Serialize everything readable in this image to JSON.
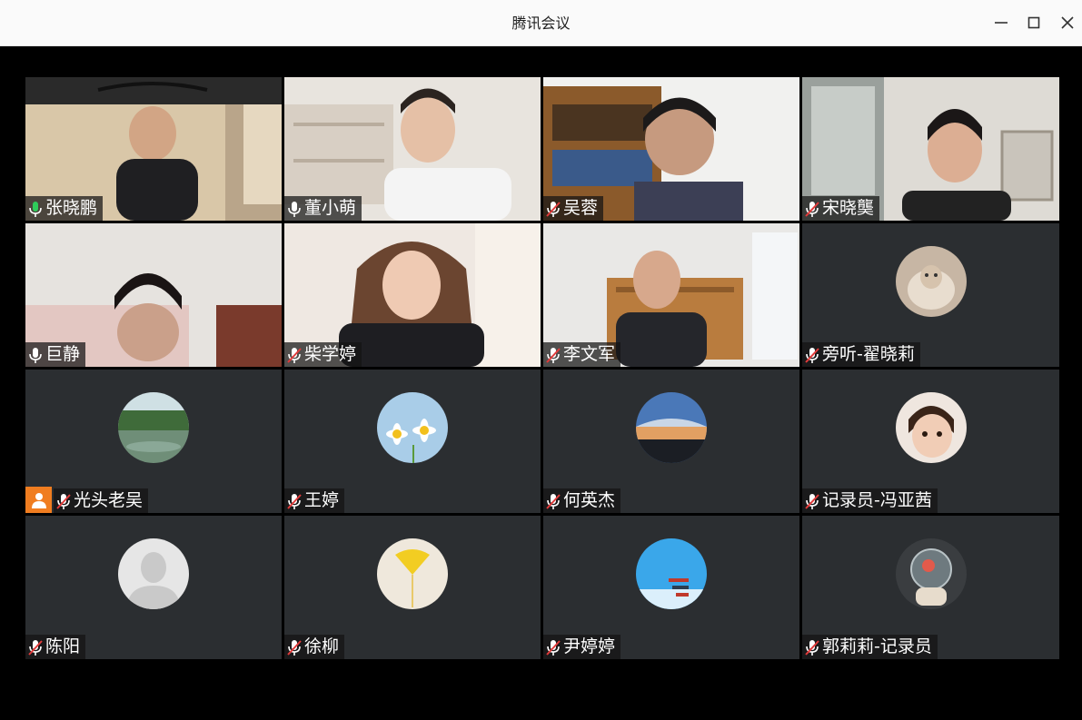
{
  "window": {
    "title": "腾讯会议",
    "minimize_icon": "minimize-icon",
    "maximize_icon": "maximize-icon",
    "close_icon": "close-icon"
  },
  "colors": {
    "active_speaker_border": "#22c55e",
    "tile_background": "#2b2e31",
    "mic_on": "#ffffff",
    "mic_muted_slash": "#e23b3b",
    "person_badge": "#f07d20"
  },
  "participants": [
    {
      "name": "张晓鹏",
      "mic": "on-speaking",
      "video": true
    },
    {
      "name": "董小萌",
      "mic": "on",
      "video": true
    },
    {
      "name": "吴蓉",
      "mic": "muted",
      "video": true
    },
    {
      "name": "宋晓龑",
      "mic": "muted",
      "video": true
    },
    {
      "name": "巨静",
      "mic": "on",
      "video": true
    },
    {
      "name": "柴学婷",
      "mic": "muted",
      "video": true
    },
    {
      "name": "李文军",
      "mic": "muted",
      "video": true
    },
    {
      "name": "旁听-翟晓莉",
      "mic": "muted",
      "video": false,
      "avatar": "sheep-avatar"
    },
    {
      "name": "光头老吴",
      "mic": "muted",
      "video": false,
      "avatar": "lake-avatar",
      "badge": "person-icon"
    },
    {
      "name": "王婷",
      "mic": "muted",
      "video": false,
      "avatar": "daisy-avatar"
    },
    {
      "name": "何英杰",
      "mic": "muted",
      "video": false,
      "avatar": "sunset-avatar"
    },
    {
      "name": "记录员-冯亚茜",
      "mic": "muted",
      "video": false,
      "avatar": "child-avatar"
    },
    {
      "name": "陈阳",
      "mic": "muted",
      "video": false,
      "avatar": "default-avatar"
    },
    {
      "name": "徐柳",
      "mic": "muted",
      "video": false,
      "avatar": "ginkgo-avatar"
    },
    {
      "name": "尹婷婷",
      "mic": "muted",
      "video": false,
      "avatar": "sky-avatar"
    },
    {
      "name": "郭莉莉-记录员",
      "mic": "muted",
      "video": false,
      "avatar": "astronaut-avatar"
    }
  ]
}
